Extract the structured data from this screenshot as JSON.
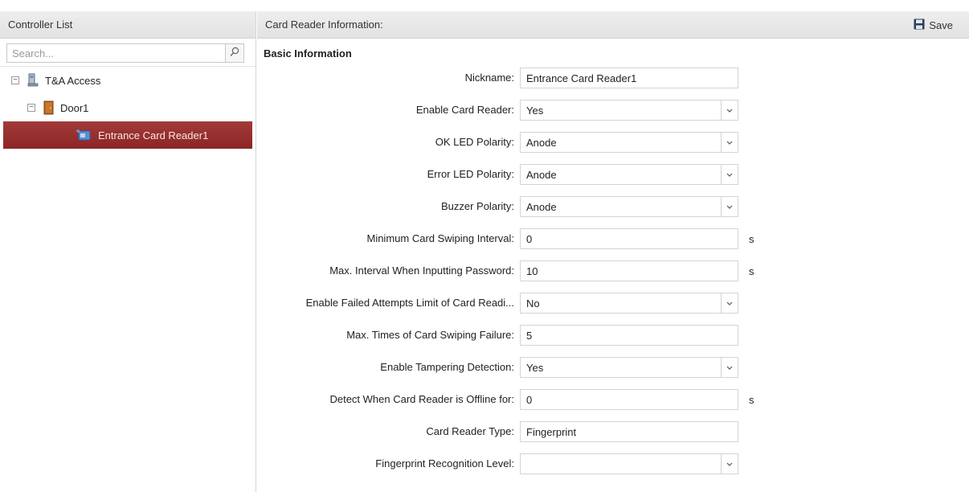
{
  "controller_list": {
    "title": "Controller List",
    "search_placeholder": "Search...",
    "tree": [
      {
        "label": "T&A Access",
        "expander": "−",
        "icon": "controller-icon"
      },
      {
        "label": "Door1",
        "expander": "−",
        "icon": "door-icon"
      },
      {
        "label": "Entrance Card Reader1",
        "icon": "card-reader-icon",
        "selected": true
      }
    ]
  },
  "card_reader": {
    "title": "Card Reader Information:",
    "save_label": "Save",
    "section_title": "Basic Information",
    "fields": [
      {
        "label": "Nickname:",
        "value": "Entrance Card Reader1",
        "type": "text",
        "unit": ""
      },
      {
        "label": "Enable Card Reader:",
        "value": "Yes",
        "type": "select",
        "unit": ""
      },
      {
        "label": "OK LED Polarity:",
        "value": "Anode",
        "type": "select",
        "unit": ""
      },
      {
        "label": "Error LED Polarity:",
        "value": "Anode",
        "type": "select",
        "unit": ""
      },
      {
        "label": "Buzzer Polarity:",
        "value": "Anode",
        "type": "select",
        "unit": ""
      },
      {
        "label": "Minimum Card Swiping Interval:",
        "value": "0",
        "type": "text",
        "unit": "s"
      },
      {
        "label": "Max. Interval When Inputting Password:",
        "value": "10",
        "type": "text",
        "unit": "s"
      },
      {
        "label": "Enable Failed Attempts Limit of Card Readi...",
        "value": "No",
        "type": "select",
        "unit": ""
      },
      {
        "label": "Max. Times of Card Swiping Failure:",
        "value": "5",
        "type": "text",
        "unit": ""
      },
      {
        "label": "Enable Tampering Detection:",
        "value": "Yes",
        "type": "select",
        "unit": ""
      },
      {
        "label": "Detect When Card Reader is Offline for:",
        "value": "0",
        "type": "text",
        "unit": "s"
      },
      {
        "label": "Card Reader Type:",
        "value": "Fingerprint",
        "type": "text",
        "unit": ""
      },
      {
        "label": "Fingerprint Recognition Level:",
        "value": "",
        "type": "select",
        "unit": ""
      }
    ]
  },
  "colors": {
    "selected_row": "#9a2e2e",
    "header_bg": "#e8e8e8"
  }
}
